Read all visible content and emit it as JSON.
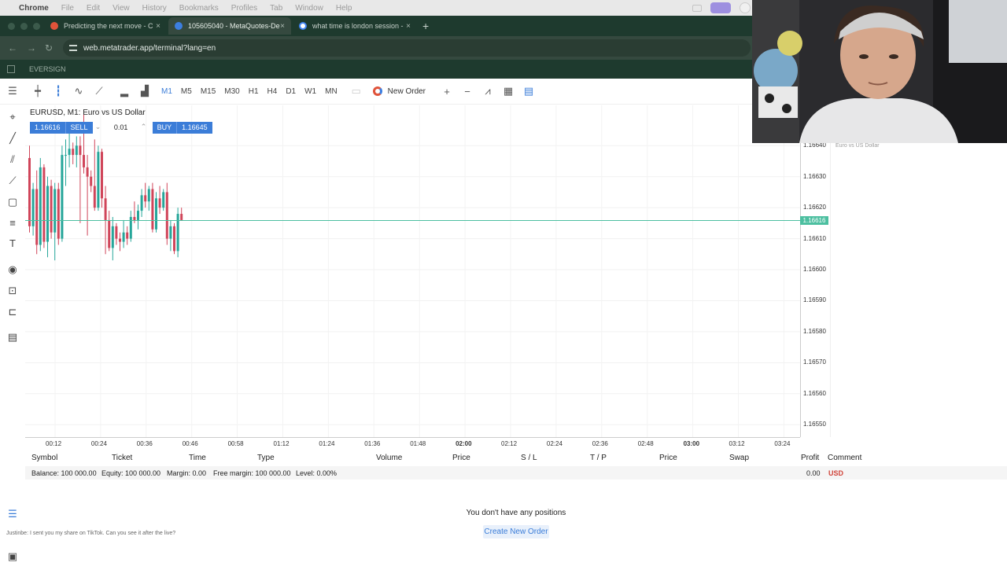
{
  "menubar": {
    "items": [
      "Chrome",
      "File",
      "Edit",
      "View",
      "History",
      "Bookmarks",
      "Profiles",
      "Tab",
      "Window",
      "Help"
    ]
  },
  "browser": {
    "tabs": [
      {
        "title": "Predicting the next move - C",
        "active": false
      },
      {
        "title": "105605040 - MetaQuotes-De",
        "active": true
      },
      {
        "title": "what time is london session -",
        "active": false
      }
    ],
    "url": "web.metatrader.app/terminal?lang=en",
    "bookmark": "EVERSIGN"
  },
  "toolbar": {
    "timeframes": [
      "M1",
      "M5",
      "M15",
      "M30",
      "H1",
      "H4",
      "D1",
      "W1",
      "MN"
    ],
    "active_timeframe": "M1",
    "new_order_label": "New Order"
  },
  "chart": {
    "title": "EURUSD, M1: Euro vs US Dollar",
    "sell_price": "1.16616",
    "sell_label": "SELL",
    "volume": "0.01",
    "buy_label": "BUY",
    "buy_price": "1.16645",
    "current_price": "1.16616",
    "market_subtitle": "Euro vs US Dollar"
  },
  "chart_data": {
    "type": "candlestick",
    "title": "EURUSD, M1: Euro vs US Dollar",
    "y_ticks": [
      "1.16640",
      "1.16630",
      "1.16620",
      "1.16610",
      "1.16600",
      "1.16590",
      "1.16580",
      "1.16570",
      "1.16560",
      "1.16550"
    ],
    "ylim": [
      1.16546,
      1.16653
    ],
    "x_ticks": [
      "00:12",
      "00:24",
      "00:36",
      "00:46",
      "00:58",
      "01:12",
      "01:24",
      "01:36",
      "01:48",
      "02:00",
      "02:12",
      "02:24",
      "02:36",
      "02:48",
      "03:00",
      "03:12",
      "03:24"
    ],
    "bold_x_ticks": [
      "02:00",
      "03:00"
    ],
    "current_price": 1.16616,
    "candles": [
      {
        "o": 1.16636,
        "h": 1.1664,
        "l": 1.16612,
        "c": 1.16614
      },
      {
        "o": 1.16614,
        "h": 1.16628,
        "l": 1.16611,
        "c": 1.16626
      },
      {
        "o": 1.16626,
        "h": 1.16632,
        "l": 1.16605,
        "c": 1.16608
      },
      {
        "o": 1.16608,
        "h": 1.16636,
        "l": 1.16606,
        "c": 1.16633
      },
      {
        "o": 1.16633,
        "h": 1.16634,
        "l": 1.16607,
        "c": 1.16609
      },
      {
        "o": 1.16609,
        "h": 1.1663,
        "l": 1.16604,
        "c": 1.16627
      },
      {
        "o": 1.16627,
        "h": 1.16629,
        "l": 1.1661,
        "c": 1.16612
      },
      {
        "o": 1.16612,
        "h": 1.16628,
        "l": 1.16603,
        "c": 1.16626
      },
      {
        "o": 1.16626,
        "h": 1.16628,
        "l": 1.16608,
        "c": 1.1661
      },
      {
        "o": 1.1661,
        "h": 1.1664,
        "l": 1.16609,
        "c": 1.16637
      },
      {
        "o": 1.16637,
        "h": 1.16642,
        "l": 1.16627,
        "c": 1.16637
      },
      {
        "o": 1.16637,
        "h": 1.16645,
        "l": 1.16633,
        "c": 1.16639
      },
      {
        "o": 1.16639,
        "h": 1.16641,
        "l": 1.16634,
        "c": 1.16637
      },
      {
        "o": 1.16637,
        "h": 1.16643,
        "l": 1.16633,
        "c": 1.1664
      },
      {
        "o": 1.1664,
        "h": 1.16643,
        "l": 1.16615,
        "c": 1.16637
      },
      {
        "o": 1.16637,
        "h": 1.1665,
        "l": 1.16631,
        "c": 1.16633
      },
      {
        "o": 1.16633,
        "h": 1.16637,
        "l": 1.16611,
        "c": 1.1663
      },
      {
        "o": 1.1663,
        "h": 1.16632,
        "l": 1.16625,
        "c": 1.16627
      },
      {
        "o": 1.16627,
        "h": 1.16642,
        "l": 1.16619,
        "c": 1.1662
      },
      {
        "o": 1.1662,
        "h": 1.1664,
        "l": 1.16619,
        "c": 1.16638
      },
      {
        "o": 1.16638,
        "h": 1.16639,
        "l": 1.1662,
        "c": 1.16623
      },
      {
        "o": 1.16623,
        "h": 1.16627,
        "l": 1.16605,
        "c": 1.16616
      },
      {
        "o": 1.16616,
        "h": 1.16619,
        "l": 1.16606,
        "c": 1.16607
      },
      {
        "o": 1.16607,
        "h": 1.16617,
        "l": 1.16603,
        "c": 1.16614
      },
      {
        "o": 1.16614,
        "h": 1.16615,
        "l": 1.16608,
        "c": 1.1661
      },
      {
        "o": 1.1661,
        "h": 1.16612,
        "l": 1.16606,
        "c": 1.16609
      },
      {
        "o": 1.16609,
        "h": 1.16616,
        "l": 1.16607,
        "c": 1.16612
      },
      {
        "o": 1.16612,
        "h": 1.16614,
        "l": 1.16608,
        "c": 1.1661
      },
      {
        "o": 1.1661,
        "h": 1.16619,
        "l": 1.16609,
        "c": 1.16617
      },
      {
        "o": 1.16617,
        "h": 1.16622,
        "l": 1.16615,
        "c": 1.16616
      },
      {
        "o": 1.16616,
        "h": 1.16621,
        "l": 1.16613,
        "c": 1.16619
      },
      {
        "o": 1.16619,
        "h": 1.16626,
        "l": 1.16617,
        "c": 1.16624
      },
      {
        "o": 1.16624,
        "h": 1.16628,
        "l": 1.1662,
        "c": 1.16622
      },
      {
        "o": 1.16622,
        "h": 1.16627,
        "l": 1.16619,
        "c": 1.16626
      },
      {
        "o": 1.16626,
        "h": 1.16628,
        "l": 1.16612,
        "c": 1.16613
      },
      {
        "o": 1.16613,
        "h": 1.16625,
        "l": 1.16612,
        "c": 1.16623
      },
      {
        "o": 1.16623,
        "h": 1.16627,
        "l": 1.16618,
        "c": 1.1662
      },
      {
        "o": 1.1662,
        "h": 1.16626,
        "l": 1.16619,
        "c": 1.16625
      },
      {
        "o": 1.16625,
        "h": 1.16628,
        "l": 1.16608,
        "c": 1.1661
      },
      {
        "o": 1.1661,
        "h": 1.16616,
        "l": 1.16606,
        "c": 1.16614
      },
      {
        "o": 1.16614,
        "h": 1.16615,
        "l": 1.16605,
        "c": 1.16606
      },
      {
        "o": 1.16606,
        "h": 1.1662,
        "l": 1.16604,
        "c": 1.16618
      },
      {
        "o": 1.16618,
        "h": 1.1662,
        "l": 1.16616,
        "c": 1.16616
      }
    ]
  },
  "table": {
    "headers": [
      "Symbol",
      "Ticket",
      "Time",
      "Type",
      "Volume",
      "Price",
      "S / L",
      "T / P",
      "Price",
      "Swap",
      "Profit",
      "Comment"
    ],
    "balance": "Balance: 100 000.00",
    "equity": "Equity: 100 000.00",
    "margin": "Margin: 0.00",
    "free_margin": "Free margin: 100 000.00",
    "level": "Level: 0.00%",
    "profit": "0.00",
    "currency": "USD",
    "empty_message": "You don't have any positions",
    "create_button": "Create New Order"
  },
  "overlay": {
    "chat_text": "Justinbe: I sent you my share on TikTok. Can you see it after the live?"
  },
  "colors": {
    "bull": "#26a69a",
    "bear": "#d0455a",
    "accent": "#3b7dd8",
    "price_line": "#4cbfa0"
  }
}
